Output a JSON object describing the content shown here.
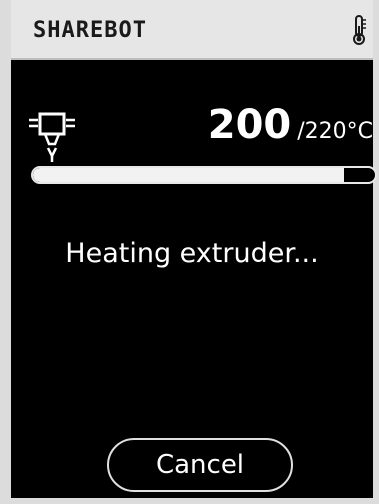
{
  "header": {
    "title": "SHAREBOT",
    "icon": "thermometer-icon"
  },
  "extruder": {
    "icon": "extruder-icon",
    "current_temp": "200",
    "target_temp": "/220°C",
    "progress_fraction": 0.91
  },
  "status": {
    "message": "Heating extruder..."
  },
  "actions": {
    "cancel_label": "Cancel"
  },
  "colors": {
    "background": "#000000",
    "header_bg": "#e6e6e6",
    "foreground": "#ffffff"
  }
}
